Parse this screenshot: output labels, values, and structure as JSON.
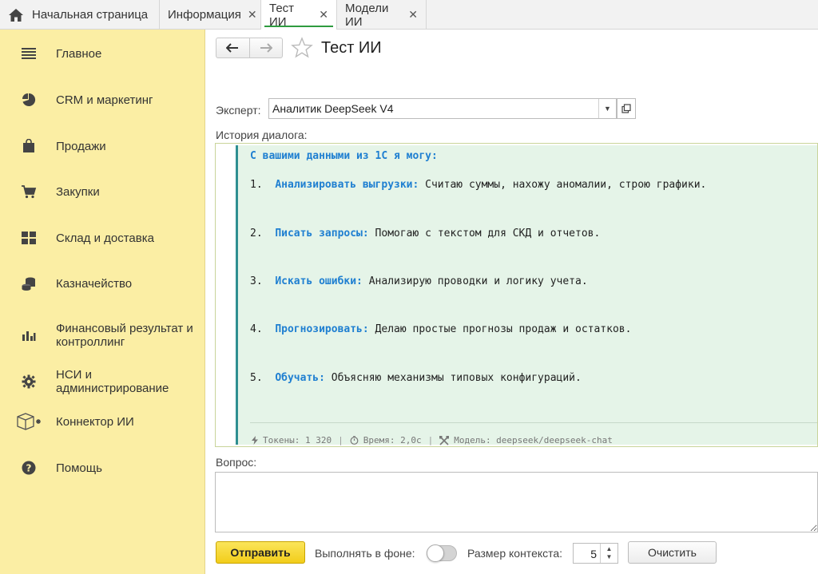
{
  "tabs": [
    {
      "label": "Начальная страница"
    },
    {
      "label": "Информация",
      "close": "✕"
    },
    {
      "label": "Тест ИИ",
      "close": "✕"
    },
    {
      "label": "Модели ИИ",
      "close": "✕"
    }
  ],
  "sidebar": {
    "items": [
      {
        "label": "Главное",
        "icon": "menu-icon"
      },
      {
        "label": "CRM и маркетинг",
        "icon": "pie-chart-icon"
      },
      {
        "label": "Продажи",
        "icon": "shopping-bag-icon"
      },
      {
        "label": "Закупки",
        "icon": "cart-icon"
      },
      {
        "label": "Склад и доставка",
        "icon": "warehouse-icon"
      },
      {
        "label": "Казначейство",
        "icon": "coins-icon"
      },
      {
        "label": "Финансовый результат и контроллинг",
        "icon": "bar-chart-icon"
      },
      {
        "label": "НСИ и администрирование",
        "icon": "gear-icon"
      },
      {
        "label": "Коннектор ИИ",
        "icon": "cube-icon"
      },
      {
        "label": "Помощь",
        "icon": "help-icon"
      }
    ]
  },
  "page": {
    "title": "Тест ИИ"
  },
  "expert": {
    "label": "Эксперт:",
    "value": "Аналитик DeepSeek V4"
  },
  "history": {
    "label": "История диалога:",
    "intro": "С вашими данными из 1С я могу:",
    "items": [
      {
        "num": "1.",
        "key": "Анализировать выгрузки:",
        "text": "Считаю суммы, нахожу аномалии, строю графики."
      },
      {
        "num": "2.",
        "key": "Писать запросы:",
        "text": "Помогаю с текстом для СКД и отчетов."
      },
      {
        "num": "3.",
        "key": "Искать ошибки:",
        "text": "Анализирую проводки и логику учета."
      },
      {
        "num": "4.",
        "key": "Прогнозировать:",
        "text": "Делаю простые прогнозы продаж и остатков."
      },
      {
        "num": "5.",
        "key": "Обучать:",
        "text": "Объясняю механизмы типовых конфигураций."
      }
    ],
    "meta": {
      "tokens": "Токены: 1 320",
      "time": "Время: 2,0с",
      "model": "Модель: deepseek/deepseek-chat"
    }
  },
  "question": {
    "label": "Вопрос:",
    "value": ""
  },
  "controls": {
    "send": "Отправить",
    "background_label": "Выполнять в фоне:",
    "background_on": false,
    "context_label": "Размер контекста:",
    "context_value": "5",
    "clear": "Очистить"
  },
  "colors": {
    "sidebar": "#fbeea4",
    "accent_green": "#2e9b3f",
    "history_bg": "#e5f4e8",
    "key_blue": "#1f7fd1",
    "send_yellow": "#f2cd1a"
  }
}
